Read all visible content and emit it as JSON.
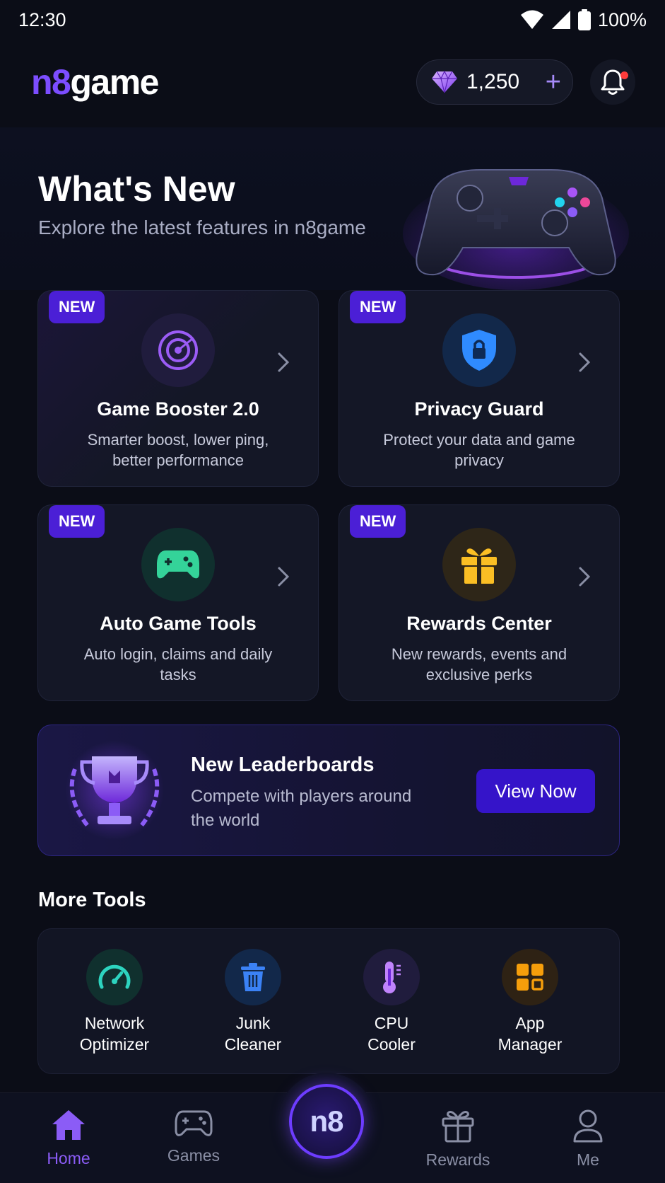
{
  "status_bar": {
    "time": "12:30",
    "battery": "100%"
  },
  "header": {
    "logo_n8": "n8",
    "logo_game": "game",
    "gems": "1,250",
    "gems_plus": "+"
  },
  "hero": {
    "title": "What's New",
    "subtitle": "Explore the latest features in n8game"
  },
  "features": [
    {
      "badge": "NEW",
      "title": "Game Booster 2.0",
      "desc": "Smarter boost, lower ping, better performance",
      "icon": "radar-icon"
    },
    {
      "badge": "NEW",
      "title": "Privacy Guard",
      "desc": "Protect your data and game privacy",
      "icon": "shield-lock-icon"
    },
    {
      "badge": "NEW",
      "title": "Auto Game Tools",
      "desc": "Auto login, claims and daily tasks",
      "icon": "gamepad-icon"
    },
    {
      "badge": "NEW",
      "title": "Rewards Center",
      "desc": "New rewards, events and exclusive perks",
      "icon": "gift-icon"
    }
  ],
  "leaderboard": {
    "title": "New Leaderboards",
    "subtitle": "Compete with players around the world",
    "button": "View Now"
  },
  "more_tools": {
    "title": "More Tools",
    "items": [
      {
        "label": "Network\nOptimizer",
        "icon": "speedometer-icon"
      },
      {
        "label": "Junk\nCleaner",
        "icon": "trash-icon"
      },
      {
        "label": "CPU\nCooler",
        "icon": "thermometer-icon"
      },
      {
        "label": "App\nManager",
        "icon": "grid-icon"
      }
    ]
  },
  "nav": {
    "home": "Home",
    "games": "Games",
    "center": "n8",
    "rewards": "Rewards",
    "me": "Me",
    "active": "home"
  },
  "colors": {
    "accent": "#7c4dff",
    "badge": "#4b1fd6",
    "button": "#3514c9",
    "background": "#0b0d17"
  }
}
